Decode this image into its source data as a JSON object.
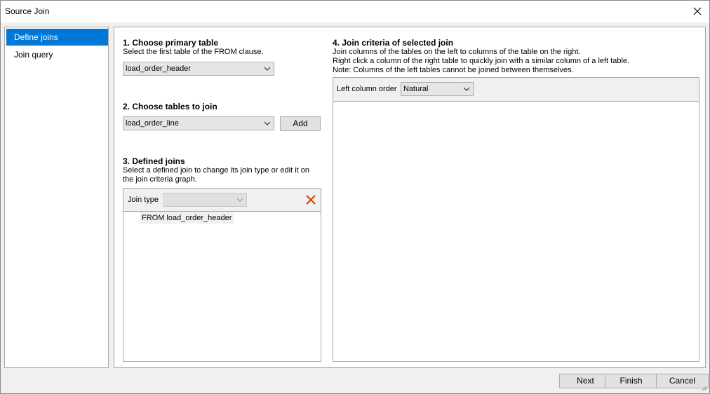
{
  "window": {
    "title": "Source Join",
    "close_icon": "close-icon"
  },
  "sidebar": {
    "items": [
      {
        "label": "Define joins",
        "selected": true
      },
      {
        "label": "Join query",
        "selected": false
      }
    ]
  },
  "section1": {
    "heading": "1. Choose primary table",
    "description": "Select the first table of the FROM clause.",
    "selected_table": "load_order_header"
  },
  "section2": {
    "heading": "2. Choose tables to join",
    "selected_table": "load_order_line",
    "add_label": "Add"
  },
  "section3": {
    "heading": "3. Defined joins",
    "description_line1": "Select a defined join to change its join type or edit it on",
    "description_line2": "the join criteria graph.",
    "join_type_label": "Join type",
    "join_type_value": "",
    "delete_icon": "delete-x-icon",
    "joins": [
      "FROM load_order_header"
    ]
  },
  "section4": {
    "heading": "4. Join criteria of selected join",
    "line1": "Join columns of the tables on the left to columns of the table on the right.",
    "line2": "Right click a column of the right table to quickly join with a similar column of a left table.",
    "line3": "Note: Columns of the left tables cannot be joined between themselves.",
    "order_label": "Left column order",
    "order_value": "Natural"
  },
  "footer": {
    "next": "Next",
    "finish": "Finish",
    "cancel": "Cancel"
  },
  "colors": {
    "accent": "#0078d7",
    "delete": "#d83b01"
  }
}
